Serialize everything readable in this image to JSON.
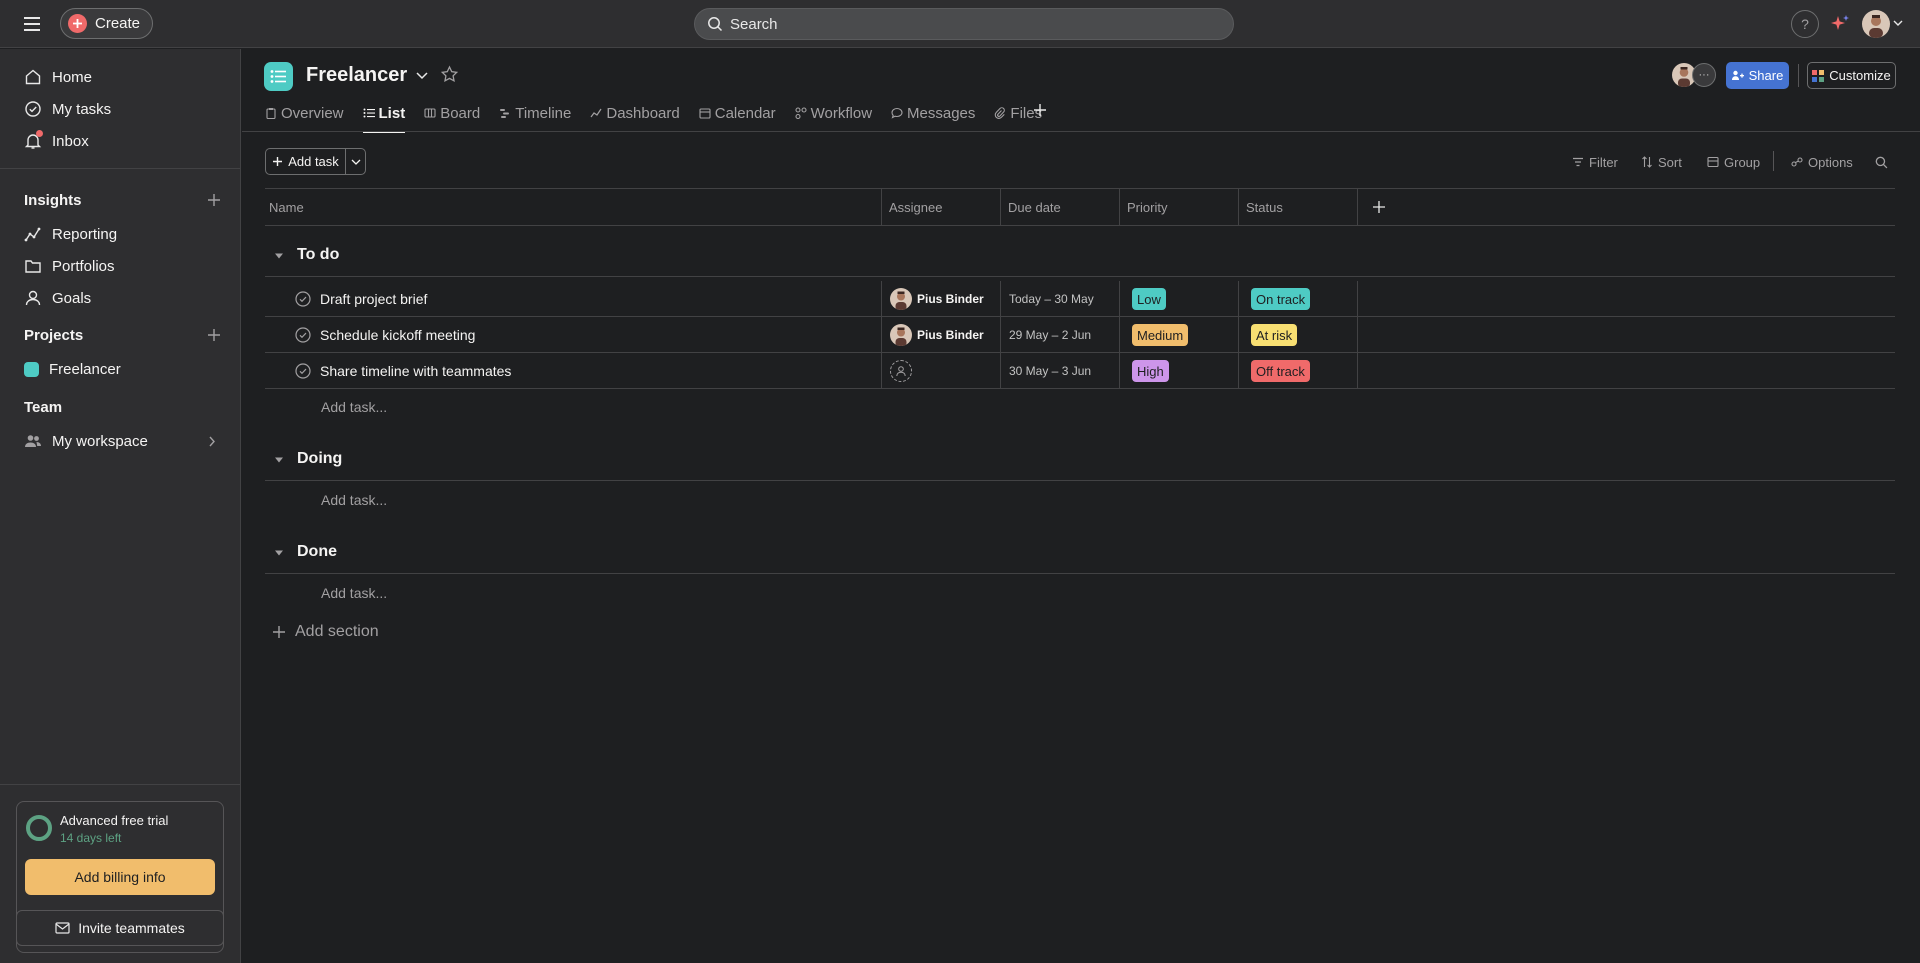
{
  "topbar": {
    "create_label": "Create",
    "search_placeholder": "Search",
    "help_label": "?"
  },
  "sidebar": {
    "nav": [
      {
        "label": "Home",
        "icon": "home-icon"
      },
      {
        "label": "My tasks",
        "icon": "check-circle-icon"
      },
      {
        "label": "Inbox",
        "icon": "bell-icon"
      }
    ],
    "insights_heading": "Insights",
    "insights": [
      {
        "label": "Reporting",
        "icon": "chart-line-icon"
      },
      {
        "label": "Portfolios",
        "icon": "folder-icon"
      },
      {
        "label": "Goals",
        "icon": "person-icon"
      }
    ],
    "projects_heading": "Projects",
    "projects": [
      {
        "label": "Freelancer",
        "color": "#4ecbc4"
      }
    ],
    "team_heading": "Team",
    "team": [
      {
        "label": "My workspace",
        "icon": "people-icon"
      }
    ],
    "trial": {
      "title": "Advanced free trial",
      "days_left": "14 days left",
      "billing_button": "Add billing info"
    },
    "invite_button": "Invite teammates"
  },
  "project": {
    "title": "Freelancer",
    "share_label": "Share",
    "customize_label": "Customize",
    "tabs": [
      {
        "label": "Overview",
        "active": false
      },
      {
        "label": "List",
        "active": true
      },
      {
        "label": "Board",
        "active": false
      },
      {
        "label": "Timeline",
        "active": false
      },
      {
        "label": "Dashboard",
        "active": false
      },
      {
        "label": "Calendar",
        "active": false
      },
      {
        "label": "Workflow",
        "active": false
      },
      {
        "label": "Messages",
        "active": false
      },
      {
        "label": "Files",
        "active": false
      }
    ]
  },
  "toolbar": {
    "add_task": "Add task",
    "filter": "Filter",
    "sort": "Sort",
    "group": "Group",
    "options": "Options"
  },
  "table": {
    "columns": [
      "Name",
      "Assignee",
      "Due date",
      "Priority",
      "Status"
    ],
    "add_task_placeholder": "Add task...",
    "add_section": "Add section",
    "sections": [
      {
        "title": "To do",
        "tasks": [
          {
            "name": "Draft project brief",
            "assignee": "Pius Binder",
            "due": "Today – 30 May",
            "priority": "Low",
            "priority_color": "#4ecbc4",
            "status": "On track",
            "status_color": "#4ecbc4"
          },
          {
            "name": "Schedule kickoff meeting",
            "assignee": "Pius Binder",
            "due": "29 May – 2 Jun",
            "priority": "Medium",
            "priority_color": "#f1bd6c",
            "status": "At risk",
            "status_color": "#f8df72"
          },
          {
            "name": "Share timeline with teammates",
            "assignee": "",
            "due": "30 May – 3 Jun",
            "priority": "High",
            "priority_color": "#cd95ea",
            "status": "Off track",
            "status_color": "#f06a6a"
          }
        ]
      },
      {
        "title": "Doing",
        "tasks": []
      },
      {
        "title": "Done",
        "tasks": []
      }
    ]
  }
}
